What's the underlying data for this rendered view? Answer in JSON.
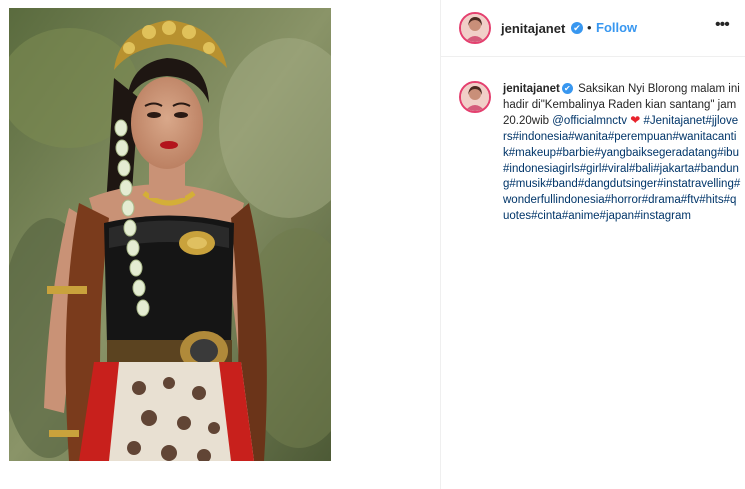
{
  "post": {
    "username": "jenitajanet",
    "follow_label": "Follow",
    "separator": "•",
    "more_glyph": "•••",
    "verified_glyph": "✔",
    "caption": {
      "text_1": "Saksikan Nyi Blorong malam ini hadir di\"Kembalinya Raden kian santang\" jam 20.20wib",
      "mention": "@officialmnctv",
      "heart": "❤",
      "hashtags": [
        "#Jenitajanet",
        "#jjlovers",
        "#indonesia",
        "#wanita",
        "#perempuan",
        "#wanitacantik",
        "#makeup",
        "#barbie",
        "#yangbaiksegeradatang",
        "#ibu",
        "#indonesiagirls",
        "#girl",
        "#viral",
        "#bali",
        "#jakarta",
        "#bandung",
        "#musik",
        "#band",
        "#dangdutsinger",
        "#instatravelling",
        "#wonderfullindonesia",
        "#horror",
        "#drama",
        "#ftv",
        "#hits",
        "#quotes",
        "#cinta",
        "#anime",
        "#japan",
        "#instagram"
      ]
    }
  },
  "colors": {
    "link_blue": "#3897f0",
    "hashtag_blue": "#003569",
    "heart_red": "#e8232c",
    "avatar_ring": "#e4406f"
  },
  "icons": {
    "verified": "verified-badge-icon",
    "more": "more-options-icon",
    "heart": "heart-emoji-icon"
  }
}
